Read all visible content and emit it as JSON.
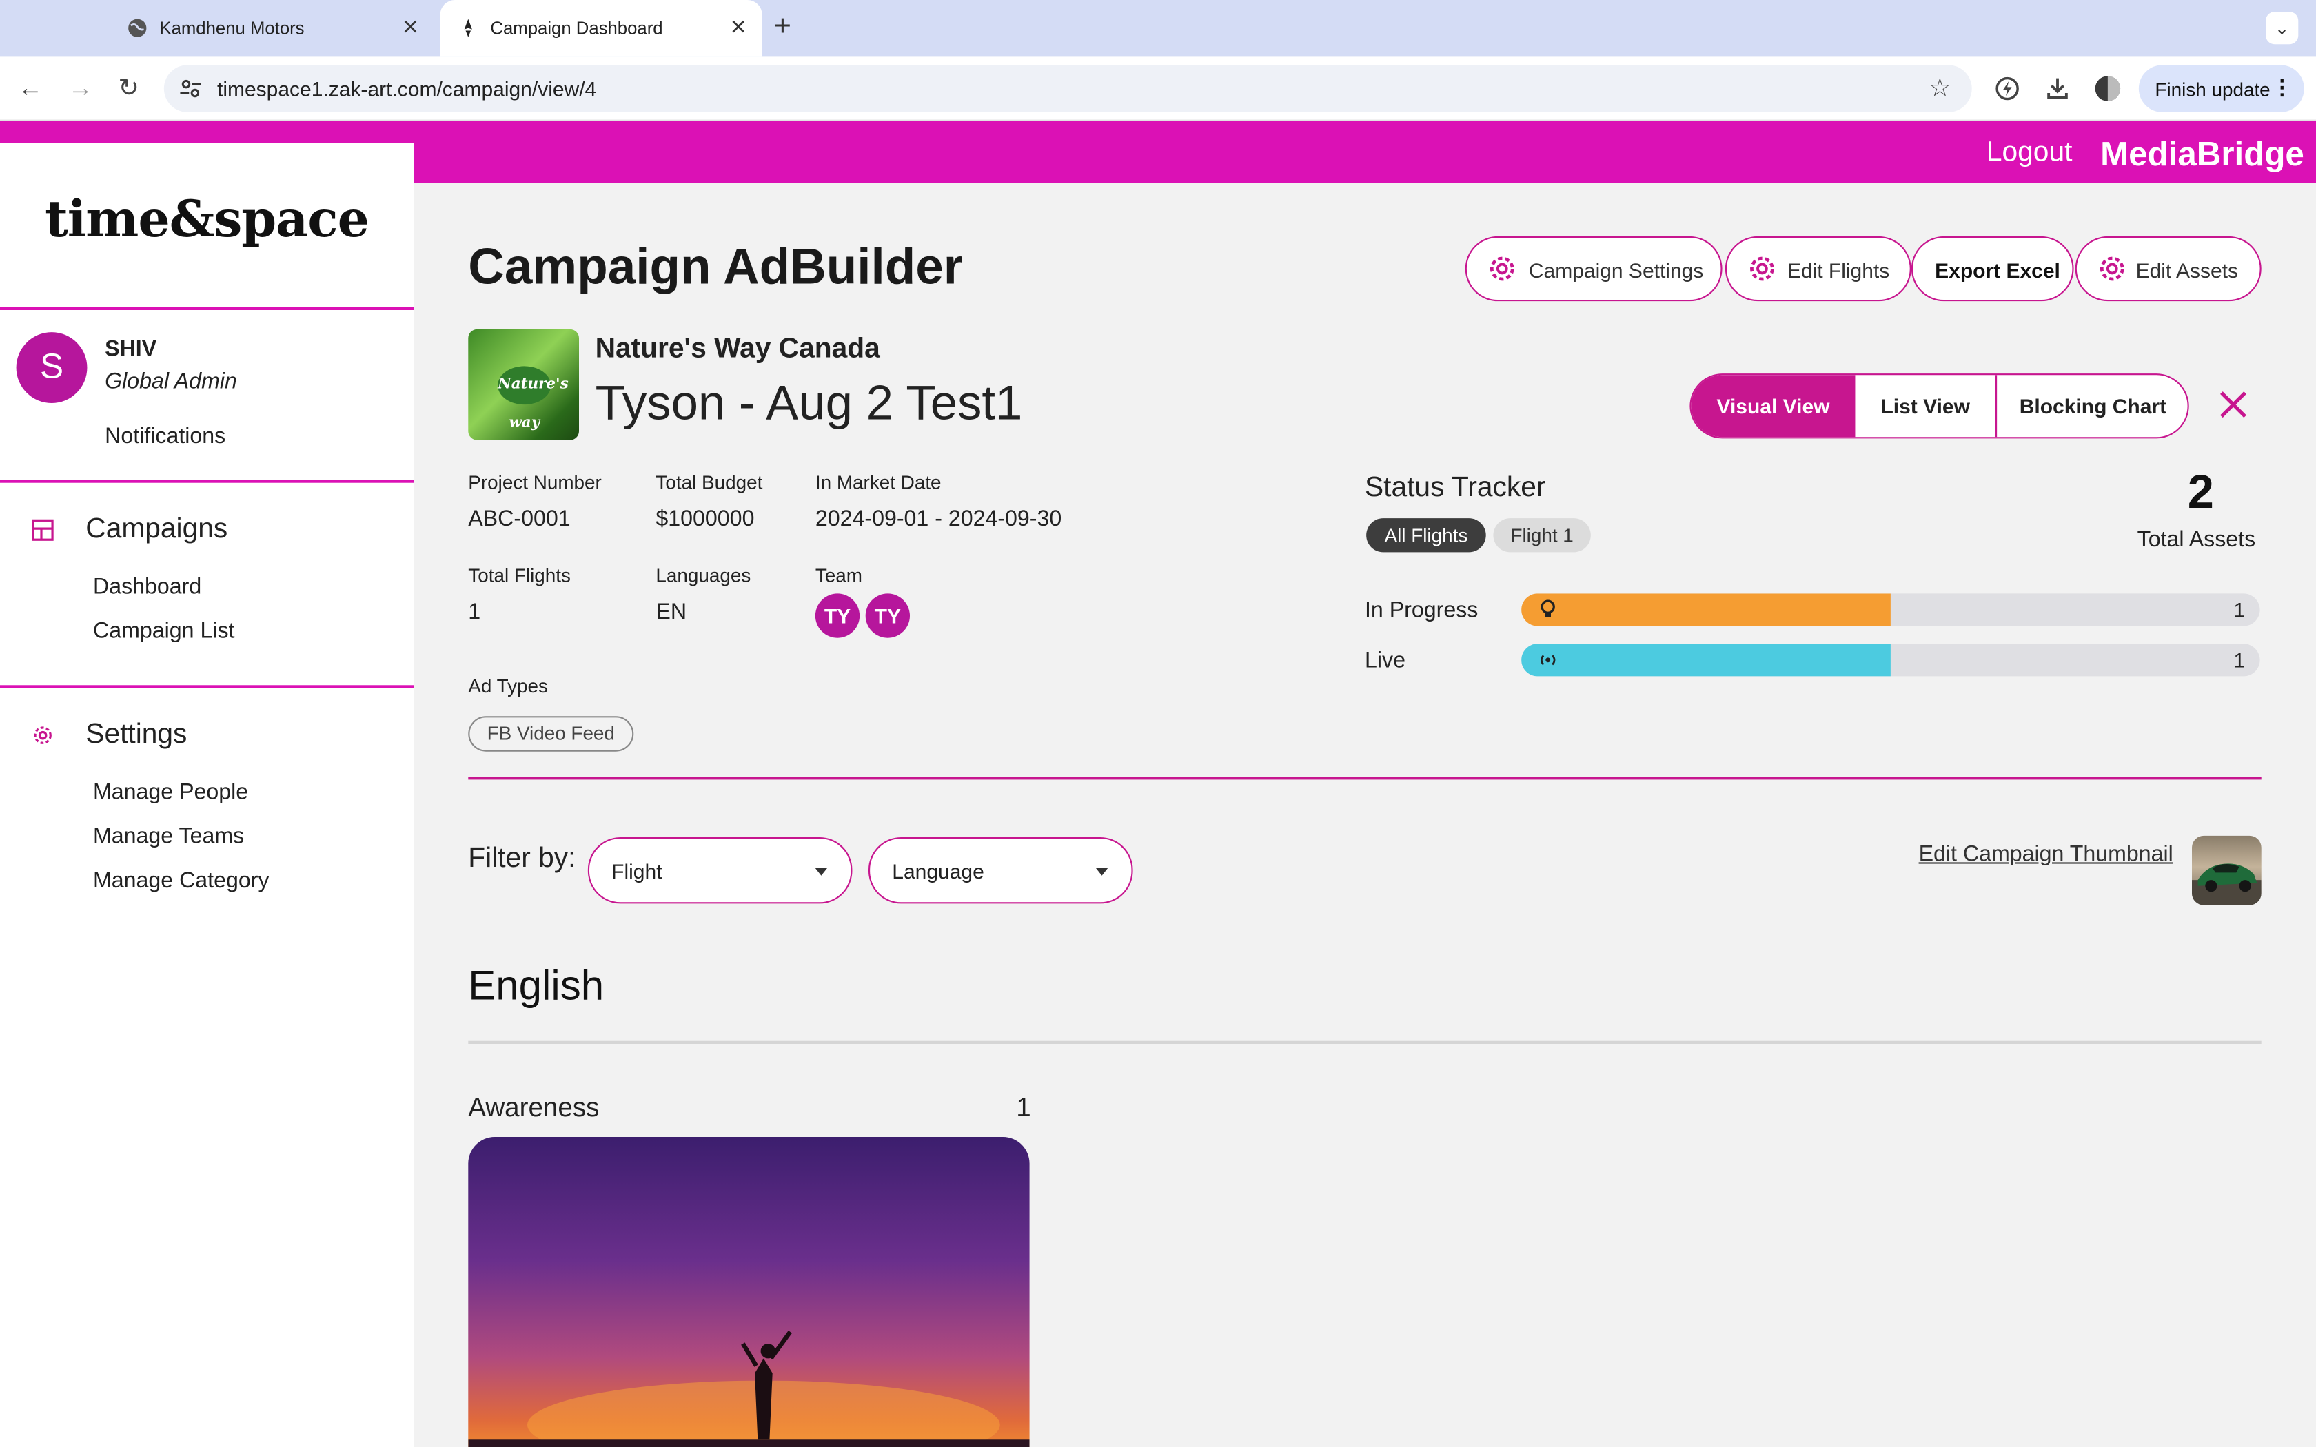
{
  "browser": {
    "tabs": [
      {
        "title": "Kamdhenu Motors",
        "active": false
      },
      {
        "title": "Campaign Dashboard",
        "active": true
      }
    ],
    "url": "timespace1.zak-art.com/campaign/view/4",
    "finish_update": "Finish update"
  },
  "appbar": {
    "logout": "Logout",
    "brand": "MediaBridge"
  },
  "sidebar": {
    "logo": "time&space",
    "user": {
      "initial": "S",
      "name": "SHIV",
      "role": "Global Admin"
    },
    "notifications": "Notifications",
    "sections": [
      {
        "title": "Campaigns",
        "items": [
          "Dashboard",
          "Campaign List"
        ]
      },
      {
        "title": "Settings",
        "items": [
          "Manage People",
          "Manage Teams",
          "Manage Category"
        ]
      }
    ]
  },
  "header": {
    "title": "Campaign AdBuilder",
    "actions": [
      "Campaign Settings",
      "Edit Flights",
      "Export Excel",
      "Edit Assets"
    ]
  },
  "campaign": {
    "thumb_text": "Nature's way",
    "client": "Nature's Way Canada",
    "name": "Tyson - Aug 2 Test1",
    "views": [
      "Visual View",
      "List View",
      "Blocking Chart"
    ],
    "active_view": "Visual View",
    "fields": {
      "project_number_label": "Project Number",
      "project_number": "ABC-0001",
      "total_budget_label": "Total Budget",
      "total_budget": "$1000000",
      "in_market_label": "In Market Date",
      "in_market": "2024-09-01 - 2024-09-30",
      "total_flights_label": "Total Flights",
      "total_flights": "1",
      "languages_label": "Languages",
      "languages": "EN",
      "team_label": "Team",
      "team": [
        "TY",
        "TY"
      ],
      "ad_types_label": "Ad Types",
      "ad_types": [
        "FB Video Feed"
      ]
    }
  },
  "status_tracker": {
    "title": "Status Tracker",
    "chips": [
      "All Flights",
      "Flight 1"
    ],
    "total_assets": "2",
    "total_assets_label": "Total Assets",
    "rows": [
      {
        "label": "In Progress",
        "count": "1",
        "fraction": 0.5,
        "color": "#f59d32",
        "icon": "lightbulb-icon"
      },
      {
        "label": "Live",
        "count": "1",
        "fraction": 0.5,
        "color": "#4ccbe0",
        "icon": "broadcast-icon"
      }
    ]
  },
  "filters": {
    "label": "Filter by:",
    "flight": "Flight",
    "language": "Language",
    "edit_thumbnail": "Edit Campaign Thumbnail"
  },
  "content": {
    "language_heading": "English",
    "group_title": "Awareness",
    "group_count": "1"
  },
  "colors": {
    "accent": "#db11b5",
    "accent_dark": "#c7168f",
    "avatar": "#b6169c"
  }
}
